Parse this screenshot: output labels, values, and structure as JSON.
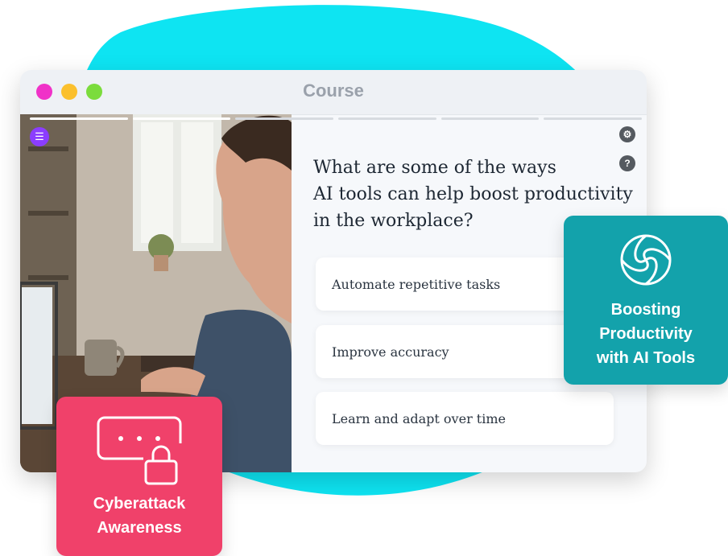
{
  "window": {
    "title": "Course"
  },
  "progress": {
    "segments_total": 6,
    "segments_done": 2
  },
  "question": {
    "lines": [
      "What are some of the ways",
      "AI tools can help boost productivity",
      "in the workplace?"
    ]
  },
  "options": [
    {
      "label": "Automate repetitive tasks"
    },
    {
      "label": "Improve accuracy"
    },
    {
      "label": "Learn and adapt over time"
    }
  ],
  "cards": {
    "teal": {
      "lines": [
        "Boosting",
        "Productivity",
        "with AI Tools"
      ],
      "icon": "aperture-icon"
    },
    "pink": {
      "lines": [
        "Cyberattack",
        "Awareness"
      ],
      "icon": "password-lock-icon"
    }
  },
  "icons": {
    "menu": "menu-icon",
    "settings": "gear-icon",
    "help": "help-icon"
  },
  "colors": {
    "accent_blob": "#0ee4f2",
    "teal_card": "#13a2ab",
    "pink_card": "#f0416a",
    "menu_button": "#8b3dff"
  }
}
